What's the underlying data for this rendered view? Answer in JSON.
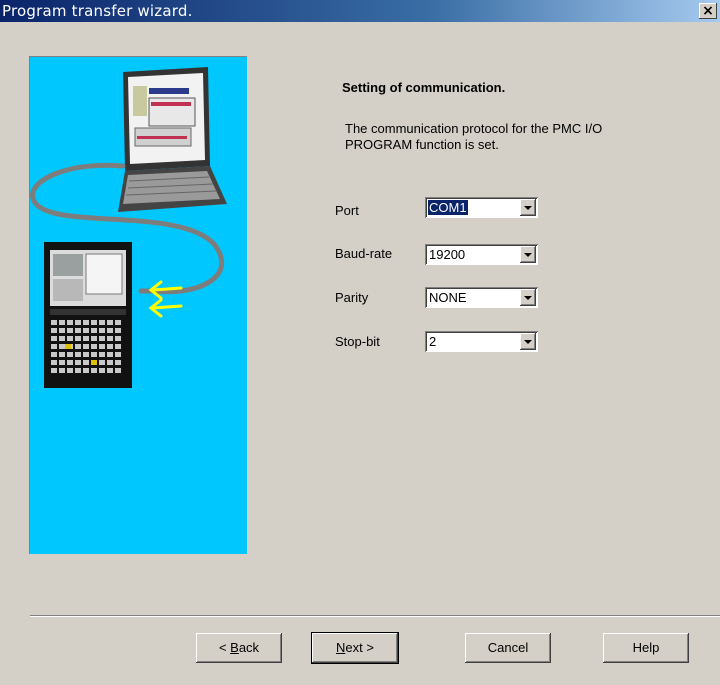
{
  "window": {
    "title": "Program transfer wizard.",
    "close_glyph": "×"
  },
  "content": {
    "heading": "Setting of communication.",
    "description_line1": "The communication protocol for the PMC I/O",
    "description_line2": "PROGRAM function is set."
  },
  "fields": {
    "port": {
      "label": "Port",
      "value": "COM1"
    },
    "baud_rate": {
      "label": "Baud-rate",
      "value": "19200"
    },
    "parity": {
      "label": "Parity",
      "value": "NONE"
    },
    "stop_bit": {
      "label": "Stop-bit",
      "value": "2"
    }
  },
  "buttons": {
    "back_prefix": "< ",
    "back_mnemonic": "B",
    "back_rest": "ack",
    "next_mnemonic": "N",
    "next_rest": "ext >",
    "cancel": "Cancel",
    "help": "Help"
  },
  "illustration": {
    "description_icons": [
      "laptop-icon",
      "cnc-controller-icon",
      "cable-icon",
      "transfer-arrows-icon"
    ],
    "background": "#00c8ff",
    "cable_color": "#7d7d7d",
    "arrow_color": "#ffff00"
  },
  "colors": {
    "title_bar": "#0a246a",
    "face": "#d4d0c8",
    "selection": "#0a246a"
  }
}
